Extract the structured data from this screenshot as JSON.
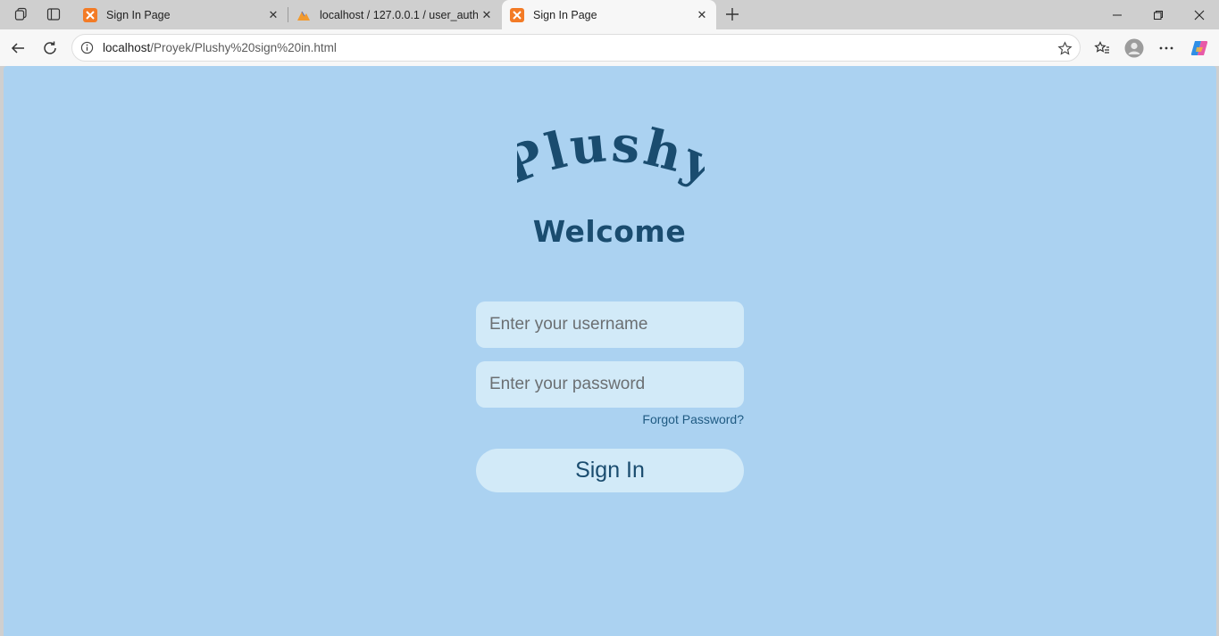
{
  "browser": {
    "tabs": [
      {
        "title": "Sign In Page",
        "favicon": "xampp-icon",
        "active": false
      },
      {
        "title": "localhost / 127.0.0.1 / user_auth /",
        "favicon": "phpmyadmin-icon",
        "active": false
      },
      {
        "title": "Sign In Page",
        "favicon": "xampp-icon",
        "active": true
      }
    ],
    "address": {
      "host": "localhost",
      "path": "/Proyek/Plushy%20sign%20in.html"
    }
  },
  "page": {
    "logo_text": "Plushy",
    "heading": "Welcome",
    "username_placeholder": "Enter your username",
    "password_placeholder": "Enter your password",
    "forgot_label": "Forgot Password?",
    "signin_label": "Sign In"
  },
  "colors": {
    "background": "#abd2f1",
    "input_bg": "#d2eaf8",
    "primary_text": "#1a4c6f",
    "link": "#1f5a82"
  }
}
